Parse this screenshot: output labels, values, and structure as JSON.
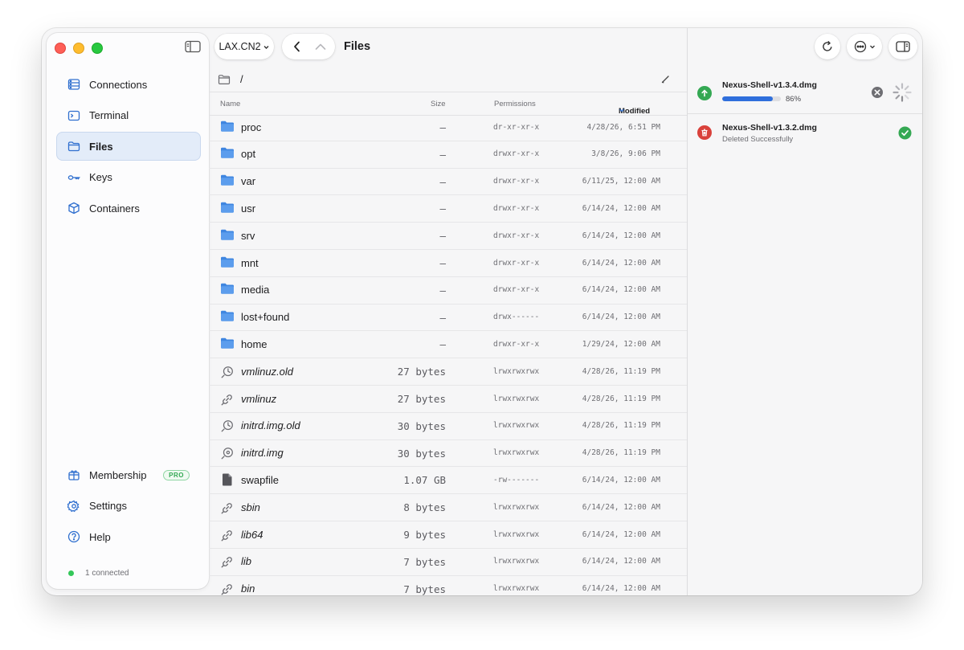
{
  "sidebar": {
    "items": [
      {
        "label": "Connections",
        "icon": "server-rack-icon"
      },
      {
        "label": "Terminal",
        "icon": "terminal-icon"
      },
      {
        "label": "Files",
        "icon": "folder-icon",
        "active": true
      },
      {
        "label": "Keys",
        "icon": "key-icon"
      },
      {
        "label": "Containers",
        "icon": "cube-icon"
      }
    ],
    "bottom_items": [
      {
        "label": "Membership",
        "icon": "gift-icon",
        "badge": "PRO"
      },
      {
        "label": "Settings",
        "icon": "gear-icon"
      },
      {
        "label": "Help",
        "icon": "question-icon"
      }
    ],
    "status": "1 connected"
  },
  "toolbar": {
    "host": "LAX.CN2",
    "title": "Files"
  },
  "path": "/",
  "columns": {
    "name": "Name",
    "size": "Size",
    "permissions": "Permissions",
    "modified": "Modified"
  },
  "files": [
    {
      "name": "proc",
      "kind": "folder",
      "size": "—",
      "perm": "dr-xr-xr-x",
      "modified": "4/28/26, 6:51 PM"
    },
    {
      "name": "opt",
      "kind": "folder",
      "size": "—",
      "perm": "drwxr-xr-x",
      "modified": "3/8/26, 9:06 PM"
    },
    {
      "name": "var",
      "kind": "folder",
      "size": "—",
      "perm": "drwxr-xr-x",
      "modified": "6/11/25, 12:00 AM"
    },
    {
      "name": "usr",
      "kind": "folder",
      "size": "—",
      "perm": "drwxr-xr-x",
      "modified": "6/14/24, 12:00 AM"
    },
    {
      "name": "srv",
      "kind": "folder",
      "size": "—",
      "perm": "drwxr-xr-x",
      "modified": "6/14/24, 12:00 AM"
    },
    {
      "name": "mnt",
      "kind": "folder",
      "size": "—",
      "perm": "drwxr-xr-x",
      "modified": "6/14/24, 12:00 AM"
    },
    {
      "name": "media",
      "kind": "folder",
      "size": "—",
      "perm": "drwxr-xr-x",
      "modified": "6/14/24, 12:00 AM"
    },
    {
      "name": "lost+found",
      "kind": "folder",
      "size": "—",
      "perm": "drwx------",
      "modified": "6/14/24, 12:00 AM"
    },
    {
      "name": "home",
      "kind": "folder",
      "size": "—",
      "perm": "drwxr-xr-x",
      "modified": "1/29/24, 12:00 AM"
    },
    {
      "name": "vmlinuz.old",
      "kind": "link-old",
      "size": "27 bytes",
      "perm": "lrwxrwxrwx",
      "modified": "4/28/26, 11:19 PM"
    },
    {
      "name": "vmlinuz",
      "kind": "link",
      "size": "27 bytes",
      "perm": "lrwxrwxrwx",
      "modified": "4/28/26, 11:19 PM"
    },
    {
      "name": "initrd.img.old",
      "kind": "link-old",
      "size": "30 bytes",
      "perm": "lrwxrwxrwx",
      "modified": "4/28/26, 11:19 PM"
    },
    {
      "name": "initrd.img",
      "kind": "link-disk",
      "size": "30 bytes",
      "perm": "lrwxrwxrwx",
      "modified": "4/28/26, 11:19 PM"
    },
    {
      "name": "swapfile",
      "kind": "file",
      "size": "1.07 GB",
      "perm": "-rw-------",
      "modified": "6/14/24, 12:00 AM"
    },
    {
      "name": "sbin",
      "kind": "link",
      "size": "8 bytes",
      "perm": "lrwxrwxrwx",
      "modified": "6/14/24, 12:00 AM"
    },
    {
      "name": "lib64",
      "kind": "link",
      "size": "9 bytes",
      "perm": "lrwxrwxrwx",
      "modified": "6/14/24, 12:00 AM"
    },
    {
      "name": "lib",
      "kind": "link",
      "size": "7 bytes",
      "perm": "lrwxrwxrwx",
      "modified": "6/14/24, 12:00 AM"
    },
    {
      "name": "bin",
      "kind": "link",
      "size": "7 bytes",
      "perm": "lrwxrwxrwx",
      "modified": "6/14/24, 12:00 AM"
    }
  ],
  "transfers": [
    {
      "name": "Nexus-Shell-v1.3.4.dmg",
      "type": "upload",
      "progress": 0.86,
      "progress_label": "86%",
      "status_icon": "spinner-icon",
      "action_icon": "cancel-icon"
    },
    {
      "name": "Nexus-Shell-v1.3.2.dmg",
      "type": "delete",
      "subtitle": "Deleted Successfully",
      "status_icon": "checkmark-icon"
    }
  ],
  "colors": {
    "accent": "#2f6fcf",
    "folder": "#4a90e2",
    "upload_green": "#34a853",
    "delete_red": "#d9413b",
    "success_green": "#34a853"
  }
}
